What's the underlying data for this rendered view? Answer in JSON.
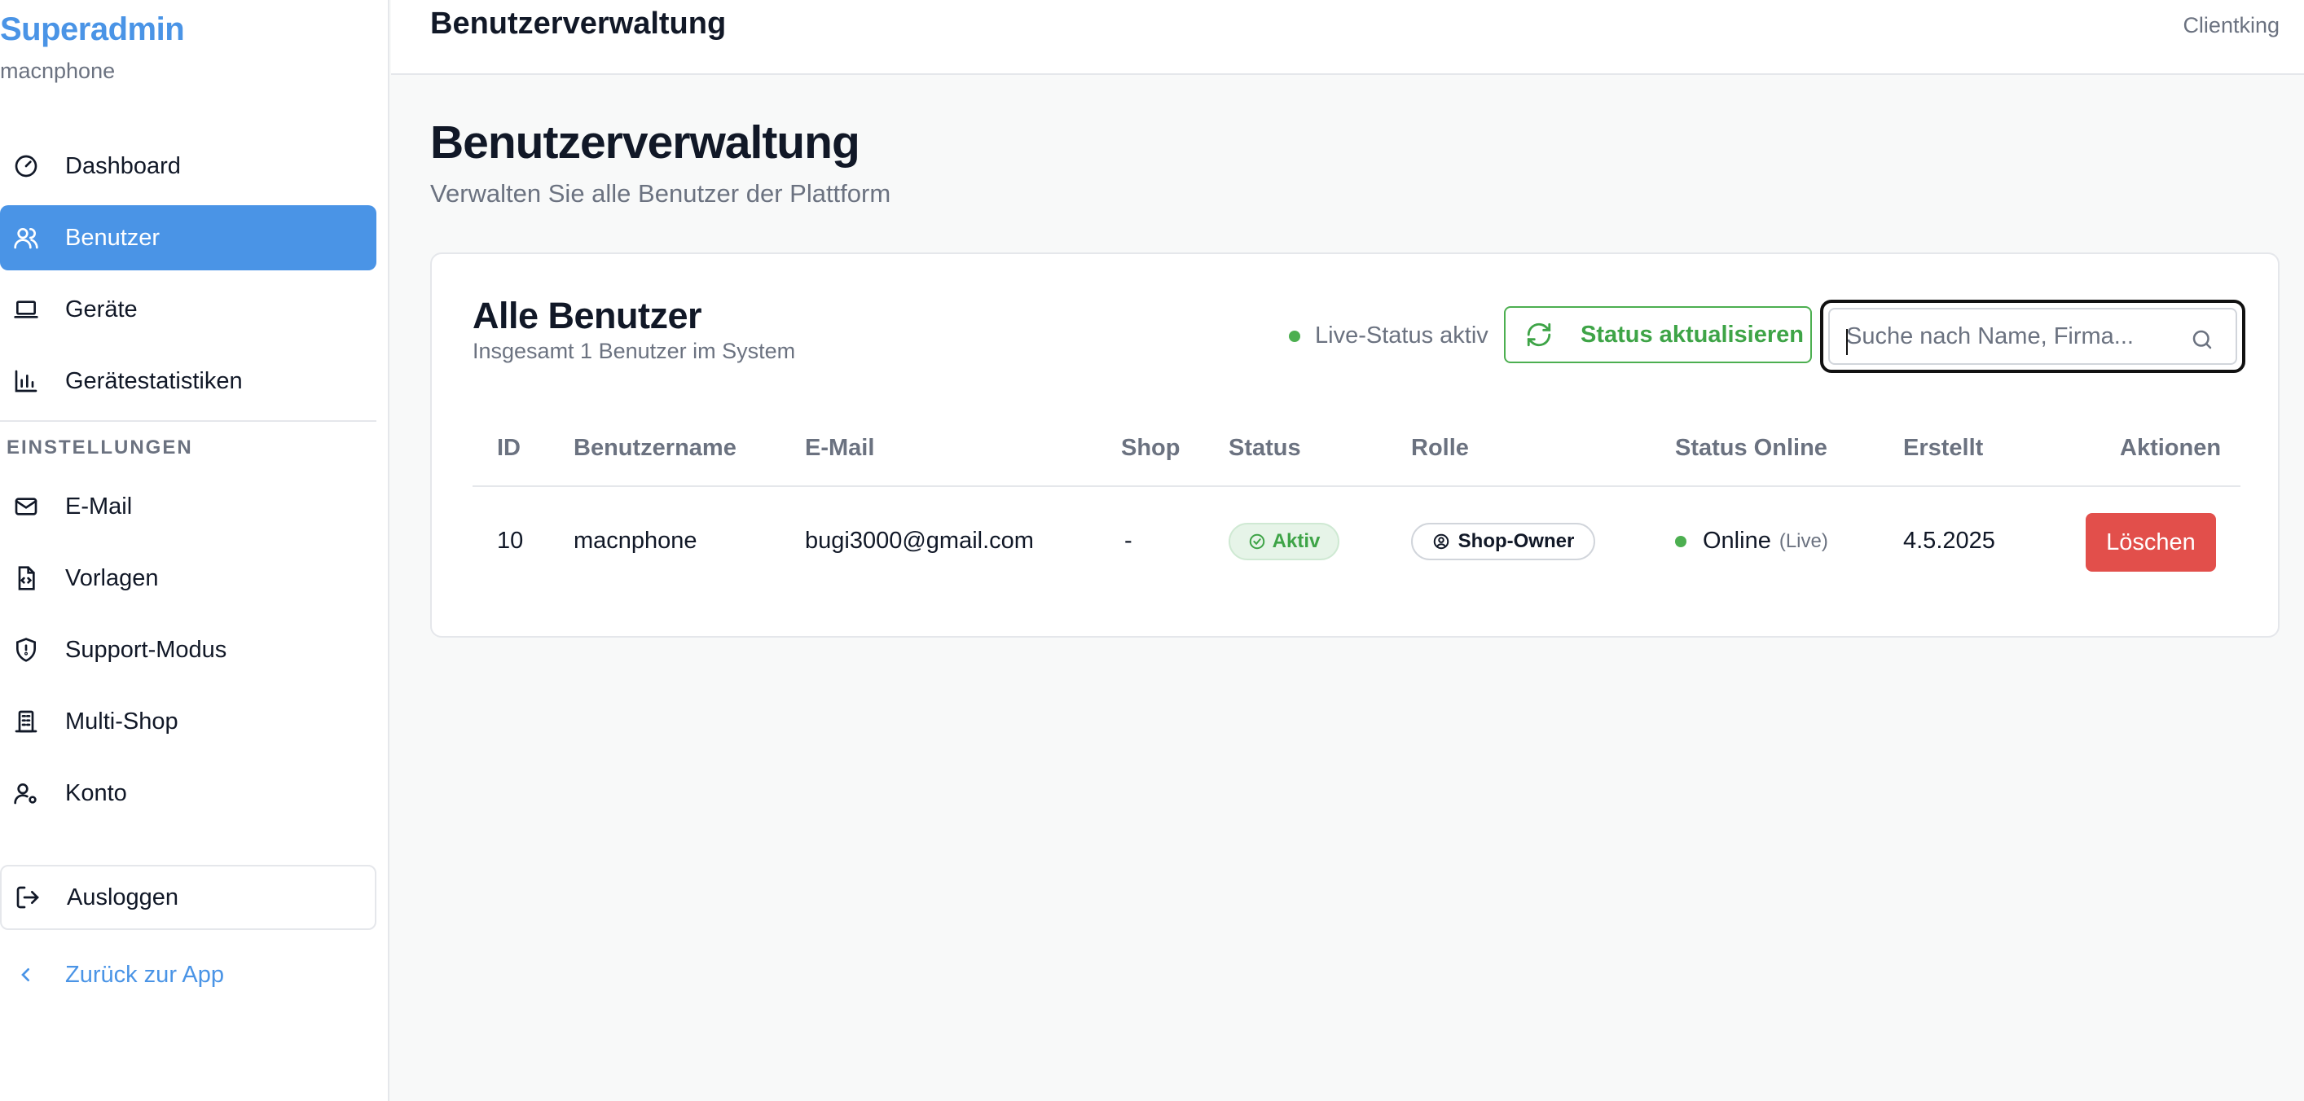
{
  "brand": {
    "title": "Superadmin",
    "subtitle": "macnphone"
  },
  "sidebar": {
    "items": [
      {
        "label": "Dashboard",
        "icon": "gauge-icon"
      },
      {
        "label": "Benutzer",
        "icon": "users-icon"
      },
      {
        "label": "Geräte",
        "icon": "laptop-icon"
      },
      {
        "label": "Gerätestatistiken",
        "icon": "bar-chart-icon"
      }
    ],
    "section_label": "EINSTELLUNGEN",
    "settings_items": [
      {
        "label": "E-Mail",
        "icon": "mail-icon"
      },
      {
        "label": "Vorlagen",
        "icon": "file-code-icon"
      },
      {
        "label": "Support-Modus",
        "icon": "shield-icon"
      },
      {
        "label": "Multi-Shop",
        "icon": "building-icon"
      },
      {
        "label": "Konto",
        "icon": "user-cog-icon"
      }
    ],
    "logout_label": "Ausloggen",
    "back_label": "Zurück zur App"
  },
  "topbar": {
    "title": "Benutzerverwaltung",
    "right": "Clientking"
  },
  "page": {
    "title": "Benutzerverwaltung",
    "subtitle": "Verwalten Sie alle Benutzer der Plattform"
  },
  "card": {
    "title": "Alle Benutzer",
    "subtitle": "Insgesamt 1 Benutzer im System",
    "live_status": "Live-Status aktiv",
    "refresh_label": "Status aktualisieren",
    "search_placeholder": "Suche nach Name, Firma..."
  },
  "table": {
    "headers": [
      "ID",
      "Benutzername",
      "E-Mail",
      "Shop",
      "Status",
      "Rolle",
      "Status Online",
      "Erstellt",
      "Aktionen"
    ],
    "rows": [
      {
        "id": "10",
        "username": "macnphone",
        "email": "bugi3000@gmail.com",
        "shop": "-",
        "status": "Aktiv",
        "role": "Shop-Owner",
        "online": "Online",
        "online_note": "(Live)",
        "created": "4.5.2025",
        "action": "Löschen"
      }
    ]
  },
  "colors": {
    "accent": "#4a94e6",
    "success": "#4caf50",
    "danger": "#e24f4b"
  }
}
